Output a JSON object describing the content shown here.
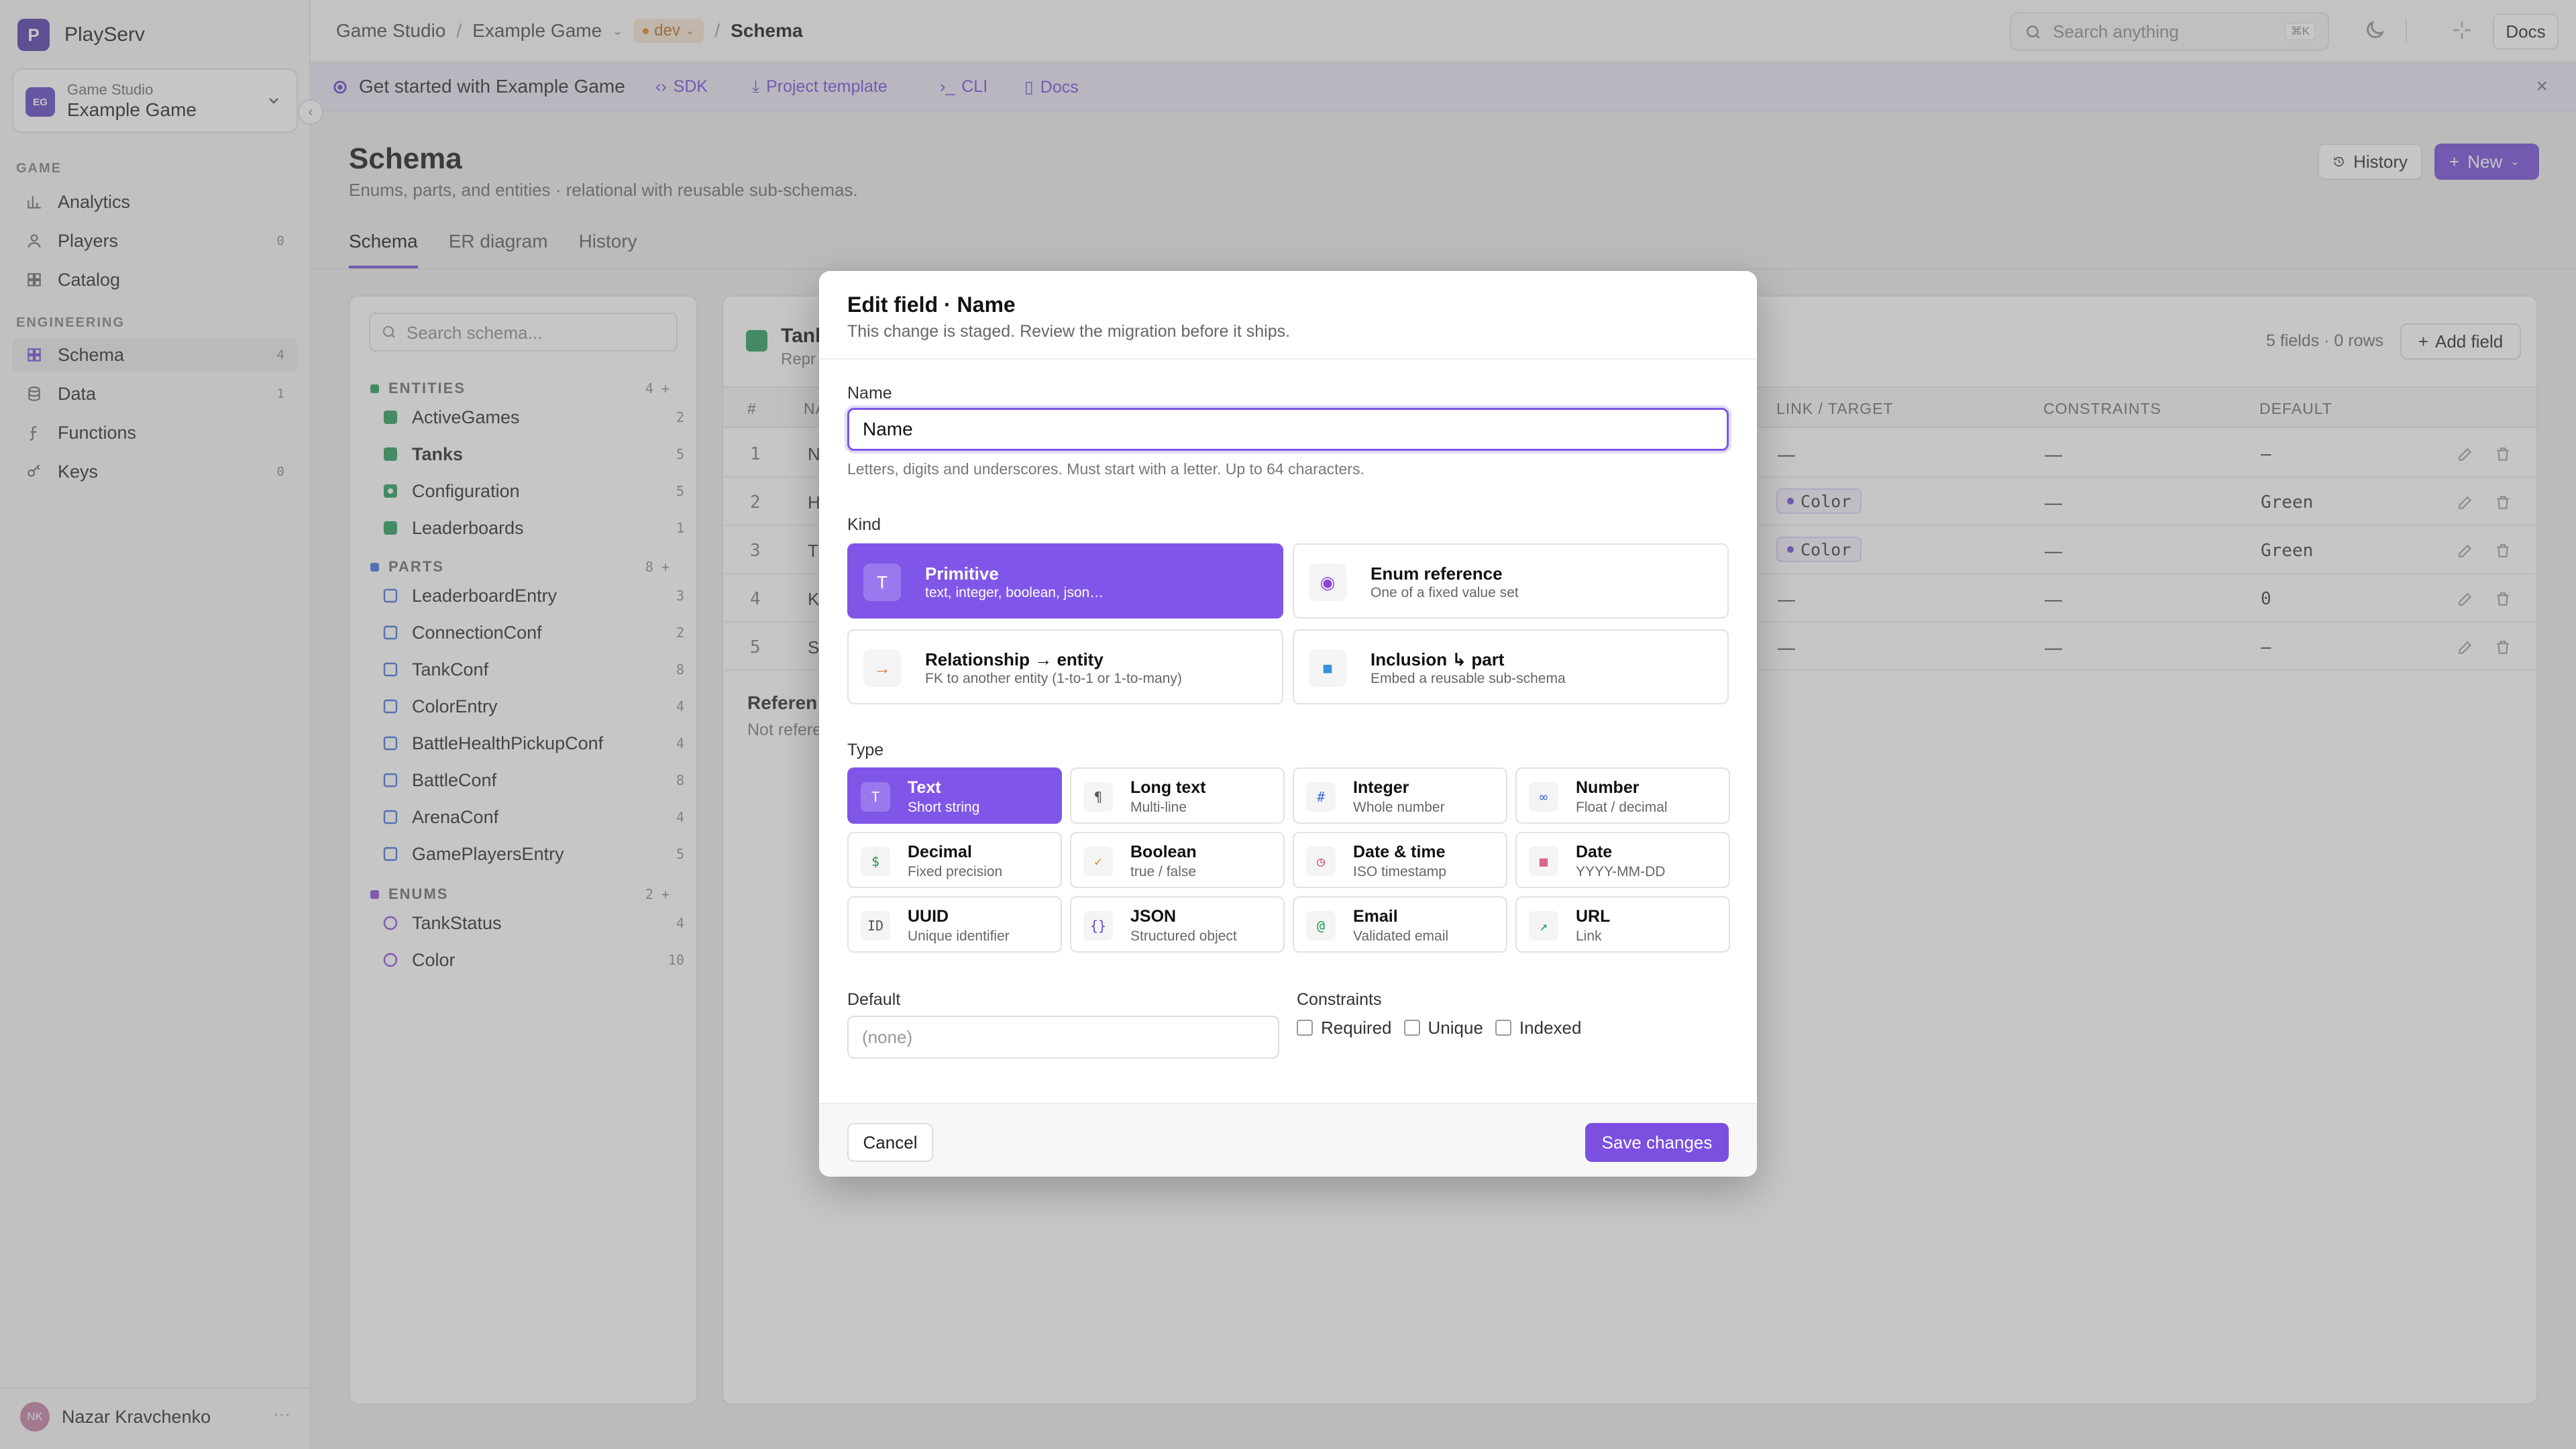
{
  "app": {
    "brand_initial": "P",
    "brand_name": "PlayServ"
  },
  "project": {
    "initials": "EG",
    "org": "Game Studio",
    "name": "Example Game"
  },
  "sidebar": {
    "game_section": "GAME",
    "engineering_section": "ENGINEERING",
    "game_items": [
      {
        "label": "Analytics",
        "icon": "bar-chart-icon",
        "count": ""
      },
      {
        "label": "Players",
        "icon": "user-icon",
        "count": "0"
      },
      {
        "label": "Catalog",
        "icon": "grid-icon",
        "count": ""
      }
    ],
    "engineering_items": [
      {
        "label": "Schema",
        "icon": "grid-icon",
        "count": "4",
        "active": true
      },
      {
        "label": "Data",
        "icon": "database-icon",
        "count": "1"
      },
      {
        "label": "Functions",
        "icon": "function-icon",
        "count": ""
      },
      {
        "label": "Keys",
        "icon": "key-icon",
        "count": "0"
      }
    ],
    "user": {
      "initials": "NK",
      "name": "Nazar Kravchenko",
      "more": "···"
    }
  },
  "topbar": {
    "breadcrumb": [
      "Game Studio",
      "Example Game",
      "Schema"
    ],
    "env": "dev",
    "search_placeholder": "Search anything",
    "search_shortcut": "⌘K",
    "docs_label": "Docs"
  },
  "banner": {
    "title": "Get started with Example Game",
    "links": [
      "SDK",
      "Project template",
      "CLI",
      "Docs"
    ],
    "link_icons": [
      "‹›",
      "⤓",
      "›_",
      "▯"
    ],
    "close": "×"
  },
  "page": {
    "title": "Schema",
    "subtitle": "Enums, parts, and entities · relational with reusable sub-schemas.",
    "history_btn": "History",
    "new_btn": "New",
    "tabs": [
      "Schema",
      "ER diagram",
      "History"
    ]
  },
  "tree": {
    "search_placeholder": "Search schema...",
    "groups": [
      {
        "label": "ENTITIES",
        "count": "4",
        "color": "#1f9a56",
        "items": [
          {
            "label": "ActiveGames",
            "count": "2",
            "style": "entity"
          },
          {
            "label": "Tanks",
            "count": "5",
            "style": "entity",
            "active": true
          },
          {
            "label": "Configuration",
            "count": "5",
            "style": "entity-dot"
          },
          {
            "label": "Leaderboards",
            "count": "1",
            "style": "entity"
          }
        ]
      },
      {
        "label": "PARTS",
        "count": "8",
        "color": "#3b6fd8",
        "items": [
          {
            "label": "LeaderboardEntry",
            "count": "3",
            "style": "part"
          },
          {
            "label": "ConnectionConf",
            "count": "2",
            "style": "part"
          },
          {
            "label": "TankConf",
            "count": "8",
            "style": "part"
          },
          {
            "label": "ColorEntry",
            "count": "4",
            "style": "part"
          },
          {
            "label": "BattleHealthPickupConf",
            "count": "4",
            "style": "part"
          },
          {
            "label": "BattleConf",
            "count": "8",
            "style": "part"
          },
          {
            "label": "ArenaConf",
            "count": "4",
            "style": "part"
          },
          {
            "label": "GamePlayersEntry",
            "count": "5",
            "style": "part"
          }
        ]
      },
      {
        "label": "ENUMS",
        "count": "2",
        "color": "#8a45d8",
        "items": [
          {
            "label": "TankStatus",
            "count": "4",
            "style": "enum"
          },
          {
            "label": "Color",
            "count": "10",
            "style": "enum"
          }
        ]
      }
    ]
  },
  "table": {
    "title": "Tank",
    "subtitle": "Repr",
    "meta": "5 fields · 0 rows",
    "add_field": "Add field",
    "headers": [
      "#",
      "NA",
      "LINK / TARGET",
      "CONSTRAINTS",
      "DEFAULT"
    ],
    "rows": [
      {
        "num": "1",
        "name": "N",
        "link": "—",
        "link_pill": false,
        "constraints": "—",
        "default": "—"
      },
      {
        "num": "2",
        "name": "H",
        "link": "Color",
        "link_pill": true,
        "constraints": "—",
        "default": "Green"
      },
      {
        "num": "3",
        "name": "T",
        "link": "Color",
        "link_pill": true,
        "constraints": "—",
        "default": "Green"
      },
      {
        "num": "4",
        "name": "K",
        "link": "—",
        "link_pill": false,
        "constraints": "—",
        "default": "0"
      },
      {
        "num": "5",
        "name": "S",
        "link": "—",
        "link_pill": false,
        "constraints": "—",
        "default": "—"
      }
    ],
    "refs_title": "Referen",
    "refs_sub": "Not refere"
  },
  "modal": {
    "title": "Edit field · Name",
    "subtitle": "This change is staged. Review the migration before it ships.",
    "name_label": "Name",
    "name_value": "Name",
    "name_help": "Letters, digits and underscores. Must start with a letter. Up to 64 characters.",
    "kind_label": "Kind",
    "kinds": [
      {
        "title": "Primitive",
        "desc": "text, integer, boolean, json…",
        "icon": "T",
        "icon_name": "text-icon",
        "selected": true
      },
      {
        "title": "Enum reference",
        "desc": "One of a fixed value set",
        "icon": "◉",
        "icon_name": "enum-icon",
        "selected": false
      },
      {
        "title": "Relationship → entity",
        "desc": "FK to another entity (1-to-1 or 1-to-many)",
        "icon": "→",
        "icon_name": "arrow-right-icon",
        "selected": false
      },
      {
        "title": "Inclusion ↳ part",
        "desc": "Embed a reusable sub-schema",
        "icon": "■",
        "icon_name": "part-icon",
        "selected": false
      }
    ],
    "type_label": "Type",
    "types": [
      {
        "title": "Text",
        "desc": "Short string",
        "icon": "T",
        "icon_name": "text-icon",
        "color": "#ffffff",
        "selected": true
      },
      {
        "title": "Long text",
        "desc": "Multi-line",
        "icon": "¶",
        "icon_name": "paragraph-icon",
        "color": "#555555",
        "selected": false
      },
      {
        "title": "Integer",
        "desc": "Whole number",
        "icon": "#",
        "icon_name": "hash-icon",
        "color": "#3b6fd8",
        "selected": false
      },
      {
        "title": "Number",
        "desc": "Float / decimal",
        "icon": "∞",
        "icon_name": "number-icon",
        "color": "#3b6fd8",
        "selected": false
      },
      {
        "title": "Decimal",
        "desc": "Fixed precision",
        "icon": "$",
        "icon_name": "dollar-icon",
        "color": "#1f9a56",
        "selected": false
      },
      {
        "title": "Boolean",
        "desc": "true / false",
        "icon": "✓",
        "icon_name": "check-icon",
        "color": "#d99a1b",
        "selected": false
      },
      {
        "title": "Date & time",
        "desc": "ISO timestamp",
        "icon": "◷",
        "icon_name": "clock-icon",
        "color": "#d23b6a",
        "selected": false
      },
      {
        "title": "Date",
        "desc": "YYYY-MM-DD",
        "icon": "▦",
        "icon_name": "calendar-icon",
        "color": "#d23b6a",
        "selected": false
      },
      {
        "title": "UUID",
        "desc": "Unique identifier",
        "icon": "ID",
        "icon_name": "id-icon",
        "color": "#555555",
        "selected": false
      },
      {
        "title": "JSON",
        "desc": "Structured object",
        "icon": "{}",
        "icon_name": "braces-icon",
        "color": "#6d45d8",
        "selected": false
      },
      {
        "title": "Email",
        "desc": "Validated email",
        "icon": "@",
        "icon_name": "at-icon",
        "color": "#1f9a56",
        "selected": false
      },
      {
        "title": "URL",
        "desc": "Link",
        "icon": "↗",
        "icon_name": "link-icon",
        "color": "#1f9a56",
        "selected": false
      }
    ],
    "default_label": "Default",
    "default_placeholder": "(none)",
    "constraints_label": "Constraints",
    "constraints": [
      "Required",
      "Unique",
      "Indexed"
    ],
    "cancel": "Cancel",
    "save": "Save changes"
  }
}
